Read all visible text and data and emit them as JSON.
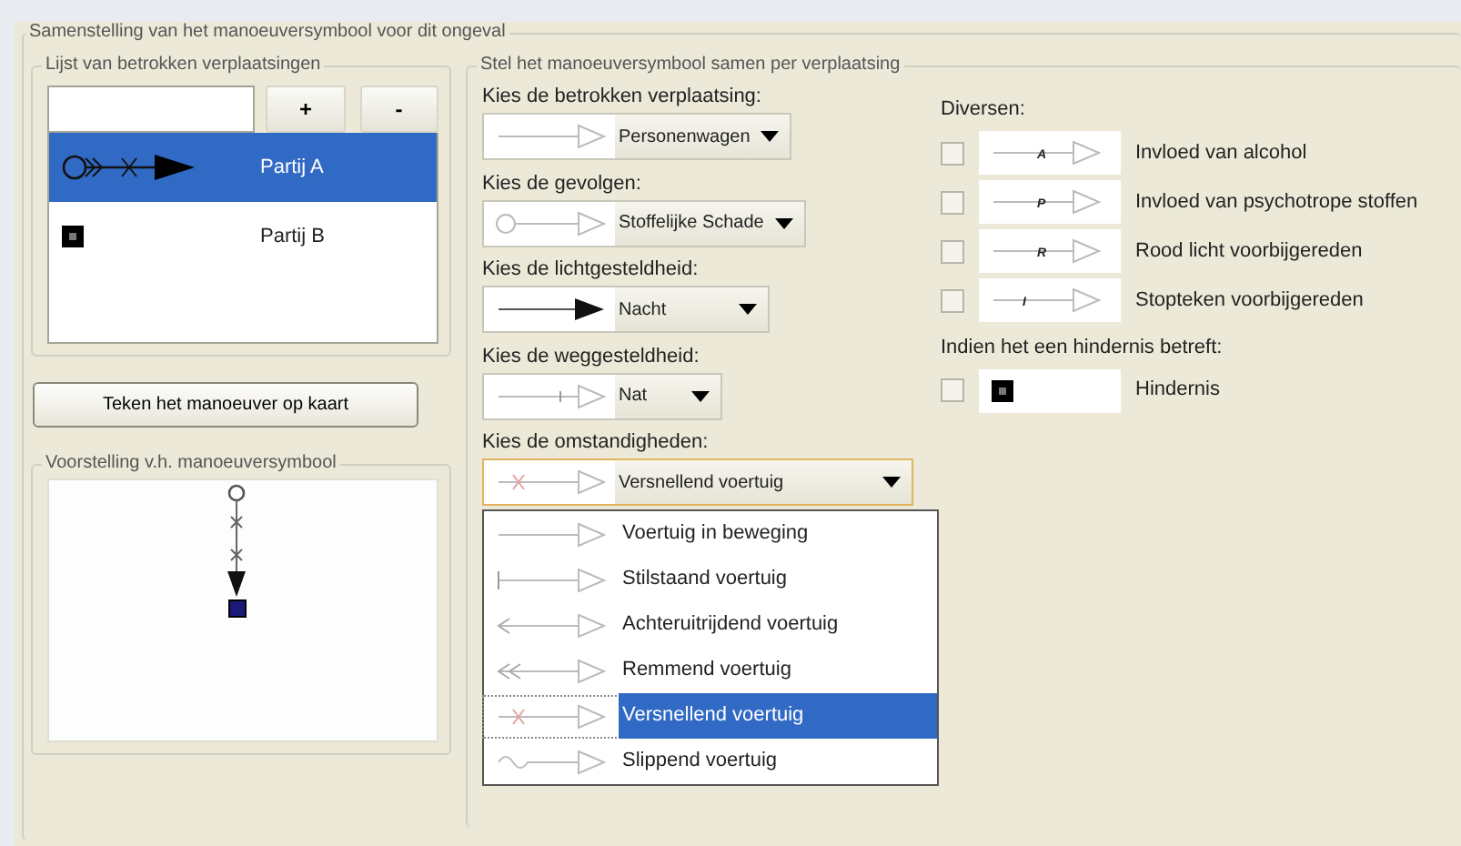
{
  "group_title": "Samenstelling van het manoeuversymbool voor dit ongeval",
  "movements_panel": {
    "title": "Lijst van betrokken verplaatsingen",
    "add_button": "+",
    "remove_button": "-",
    "items": [
      {
        "label": "Partij A",
        "kind": "vehicle",
        "selected": true
      },
      {
        "label": "Partij B",
        "kind": "obstacle",
        "selected": false
      }
    ]
  },
  "draw_button": "Teken het manoeuver op kaart",
  "preview_panel": {
    "title": "Voorstelling v.h. manoeuversymbool"
  },
  "compose_panel": {
    "title": "Stel het manoeuversymbool samen per verplaatsing",
    "selectors": [
      {
        "label": "Kies de betrokken verplaatsing:",
        "value": "Personenwagen",
        "kind": "plain",
        "focused": false
      },
      {
        "label": "Kies de gevolgen:",
        "value": "Stoffelijke Schade",
        "kind": "circle",
        "focused": false
      },
      {
        "label": "Kies de lichtgesteldheid:",
        "value": "Nacht",
        "kind": "filled",
        "focused": false
      },
      {
        "label": "Kies de weggesteldheid:",
        "value": "Nat",
        "kind": "tick",
        "focused": false
      },
      {
        "label": "Kies de omstandigheden:",
        "value": "Versnellend voertuig",
        "kind": "cross",
        "focused": true
      }
    ],
    "dropdown": [
      {
        "label": "Voertuig in beweging",
        "kind": "plain",
        "selected": false
      },
      {
        "label": "Stilstaand voertuig",
        "kind": "bar",
        "selected": false
      },
      {
        "label": "Achteruitrijdend voertuig",
        "kind": "back",
        "selected": false
      },
      {
        "label": "Remmend voertuig",
        "kind": "brake",
        "selected": false
      },
      {
        "label": "Versnellend voertuig",
        "kind": "cross",
        "selected": true
      },
      {
        "label": "Slippend voertuig",
        "kind": "wave",
        "selected": false
      }
    ],
    "misc": {
      "title": "Diversen:",
      "items": [
        {
          "label": "Invloed van alcohol",
          "mark": "A",
          "checked": false
        },
        {
          "label": "Invloed van psychotrope stoffen",
          "mark": "P",
          "checked": false
        },
        {
          "label": "Rood licht voorbijgereden",
          "mark": "R",
          "checked": false
        },
        {
          "label": "Stopteken voorbijgereden",
          "mark": "I",
          "checked": false
        }
      ]
    },
    "obstacle": {
      "title": "Indien het een hindernis betreft:",
      "items": [
        {
          "label": "Hindernis",
          "checked": false
        }
      ]
    }
  }
}
